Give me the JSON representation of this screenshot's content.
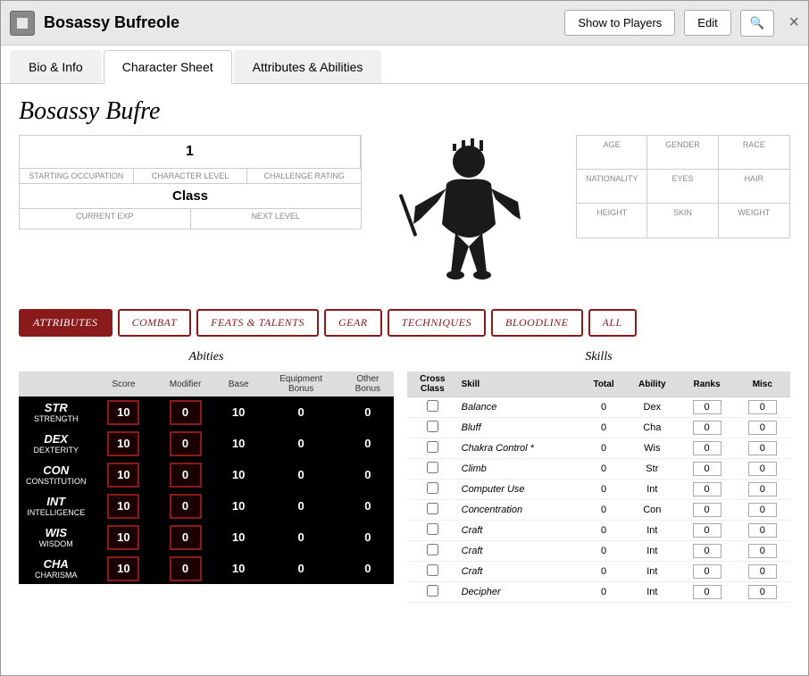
{
  "window": {
    "title": "Bosassy Bufreole",
    "show_players_label": "Show to Players",
    "edit_label": "Edit",
    "close_label": "×"
  },
  "tabs": [
    {
      "id": "bio",
      "label": "Bio & Info",
      "active": false
    },
    {
      "id": "sheet",
      "label": "Character Sheet",
      "active": true
    },
    {
      "id": "attrs",
      "label": "Attributes & Abilities",
      "active": false
    }
  ],
  "character": {
    "name": "Bosassy Bufre",
    "level": "1",
    "starting_occupation_label": "Starting Occupation",
    "character_level_label": "Character Level",
    "challenge_rating_label": "Challenge Rating",
    "class_label": "Class",
    "current_exp_label": "Current EXP",
    "next_level_label": "Next Level",
    "age_label": "Age",
    "gender_label": "Gender",
    "race_label": "Race",
    "nationality_label": "Nationality",
    "eyes_label": "Eyes",
    "hair_label": "Hair",
    "height_label": "Height",
    "skin_label": "Skin",
    "weight_label": "Weight"
  },
  "filter_buttons": [
    {
      "id": "attributes",
      "label": "Attributes",
      "active": true
    },
    {
      "id": "combat",
      "label": "Combat",
      "active": false
    },
    {
      "id": "feats",
      "label": "Feats & Talents",
      "active": false
    },
    {
      "id": "gear",
      "label": "Gear",
      "active": false
    },
    {
      "id": "techniques",
      "label": "Techniques",
      "active": false
    },
    {
      "id": "bloodline",
      "label": "Bloodline",
      "active": false
    },
    {
      "id": "all",
      "label": "All",
      "active": false
    }
  ],
  "abilities": {
    "title": "Abities",
    "headers": [
      "",
      "Score",
      "Modifier",
      "Base",
      "Equipment Bonus",
      "Other Bonus"
    ],
    "stats": [
      {
        "abbr": "STR",
        "name": "Strength",
        "score": "10",
        "modifier": "0",
        "base": "10",
        "eq_bonus": "0",
        "other_bonus": "0"
      },
      {
        "abbr": "DEX",
        "name": "Dexterity",
        "score": "10",
        "modifier": "0",
        "base": "10",
        "eq_bonus": "0",
        "other_bonus": "0"
      },
      {
        "abbr": "CON",
        "name": "Constitution",
        "score": "10",
        "modifier": "0",
        "base": "10",
        "eq_bonus": "0",
        "other_bonus": "0"
      },
      {
        "abbr": "INT",
        "name": "Intelligence",
        "score": "10",
        "modifier": "0",
        "base": "10",
        "eq_bonus": "0",
        "other_bonus": "0"
      },
      {
        "abbr": "WIS",
        "name": "Wisdom",
        "score": "10",
        "modifier": "0",
        "base": "10",
        "eq_bonus": "0",
        "other_bonus": "0"
      },
      {
        "abbr": "CHA",
        "name": "Charisma",
        "score": "10",
        "modifier": "0",
        "base": "10",
        "eq_bonus": "0",
        "other_bonus": "0"
      }
    ]
  },
  "skills": {
    "title": "Skills",
    "headers": [
      "Cross Class",
      "Skill",
      "Total",
      "Ability",
      "Ranks",
      "Misc"
    ],
    "rows": [
      {
        "cross_class": false,
        "name": "Balance",
        "total": "0",
        "ability": "Dex",
        "ranks": "0",
        "misc": "0"
      },
      {
        "cross_class": false,
        "name": "Bluff",
        "total": "0",
        "ability": "Cha",
        "ranks": "0",
        "misc": "0"
      },
      {
        "cross_class": false,
        "name": "Chakra Control *",
        "total": "0",
        "ability": "Wis",
        "ranks": "0",
        "misc": "0"
      },
      {
        "cross_class": false,
        "name": "Climb",
        "total": "0",
        "ability": "Str",
        "ranks": "0",
        "misc": "0"
      },
      {
        "cross_class": false,
        "name": "Computer Use",
        "total": "0",
        "ability": "Int",
        "ranks": "0",
        "misc": "0"
      },
      {
        "cross_class": false,
        "name": "Concentration",
        "total": "0",
        "ability": "Con",
        "ranks": "0",
        "misc": "0"
      },
      {
        "cross_class": false,
        "name": "Craft",
        "total": "0",
        "ability": "Int",
        "ranks": "0",
        "misc": "0"
      },
      {
        "cross_class": false,
        "name": "Craft",
        "total": "0",
        "ability": "Int",
        "ranks": "0",
        "misc": "0"
      },
      {
        "cross_class": false,
        "name": "Craft",
        "total": "0",
        "ability": "Int",
        "ranks": "0",
        "misc": "0"
      },
      {
        "cross_class": false,
        "name": "Decipher",
        "total": "0",
        "ability": "Int",
        "ranks": "0",
        "misc": "0"
      }
    ]
  }
}
